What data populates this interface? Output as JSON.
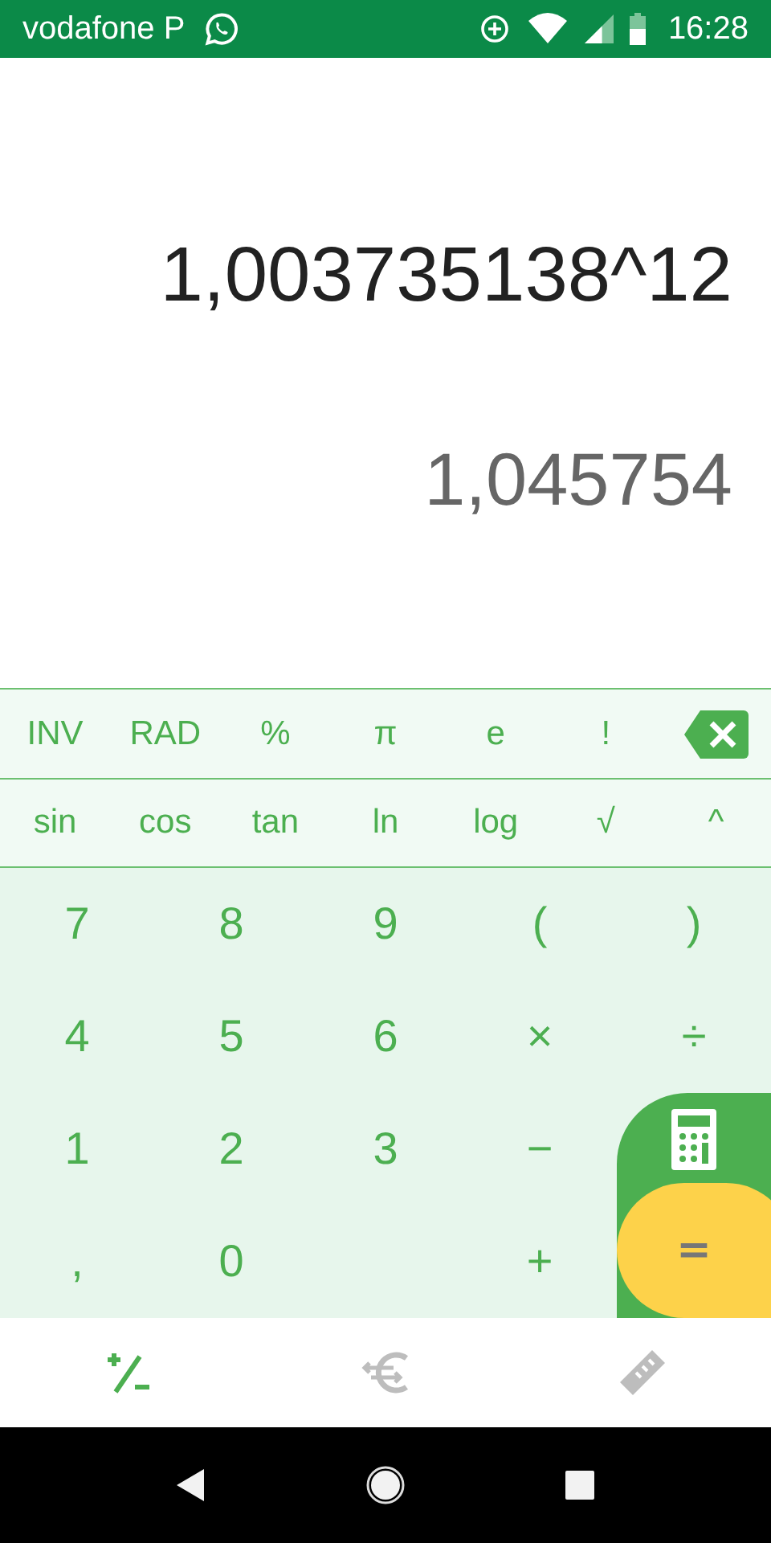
{
  "status_bar": {
    "carrier": "vodafone P",
    "time": "16:28"
  },
  "display": {
    "expression": "1,003735138^12",
    "result": "1,045754"
  },
  "function_rows": [
    {
      "keys": [
        {
          "kind": "text",
          "label": "INV"
        },
        {
          "kind": "text",
          "label": "RAD"
        },
        {
          "kind": "text",
          "label": "%"
        },
        {
          "kind": "text",
          "label": "π"
        },
        {
          "kind": "text",
          "label": "e"
        },
        {
          "kind": "text",
          "label": "!"
        },
        {
          "kind": "backspace"
        }
      ]
    },
    {
      "keys": [
        {
          "kind": "text",
          "label": "sin"
        },
        {
          "kind": "text",
          "label": "cos"
        },
        {
          "kind": "text",
          "label": "tan"
        },
        {
          "kind": "text",
          "label": "ln"
        },
        {
          "kind": "text",
          "label": "log"
        },
        {
          "kind": "text",
          "label": "√"
        },
        {
          "kind": "text",
          "label": "^"
        }
      ]
    }
  ],
  "keypad": [
    {
      "keys": [
        {
          "kind": "text",
          "label": "7"
        },
        {
          "kind": "text",
          "label": "8"
        },
        {
          "kind": "text",
          "label": "9"
        },
        {
          "kind": "text",
          "label": "("
        },
        {
          "kind": "text",
          "label": ")"
        }
      ]
    },
    {
      "keys": [
        {
          "kind": "text",
          "label": "4"
        },
        {
          "kind": "text",
          "label": "5"
        },
        {
          "kind": "text",
          "label": "6"
        },
        {
          "kind": "text",
          "label": "×"
        },
        {
          "kind": "text",
          "label": "÷"
        }
      ]
    },
    {
      "keys": [
        {
          "kind": "text",
          "label": "1"
        },
        {
          "kind": "text",
          "label": "2"
        },
        {
          "kind": "text",
          "label": "3"
        },
        {
          "kind": "text",
          "label": "−"
        },
        {
          "kind": "blank"
        }
      ]
    },
    {
      "keys": [
        {
          "kind": "text",
          "label": ","
        },
        {
          "kind": "text",
          "label": "0"
        },
        {
          "kind": "blank"
        },
        {
          "kind": "text",
          "label": "+"
        },
        {
          "kind": "blank"
        }
      ]
    }
  ],
  "equals_button": {
    "label": "="
  },
  "bottom_tabs": [
    {
      "kind": "calculator",
      "selected": true
    },
    {
      "kind": "currency",
      "selected": false
    },
    {
      "kind": "units",
      "selected": false
    }
  ]
}
